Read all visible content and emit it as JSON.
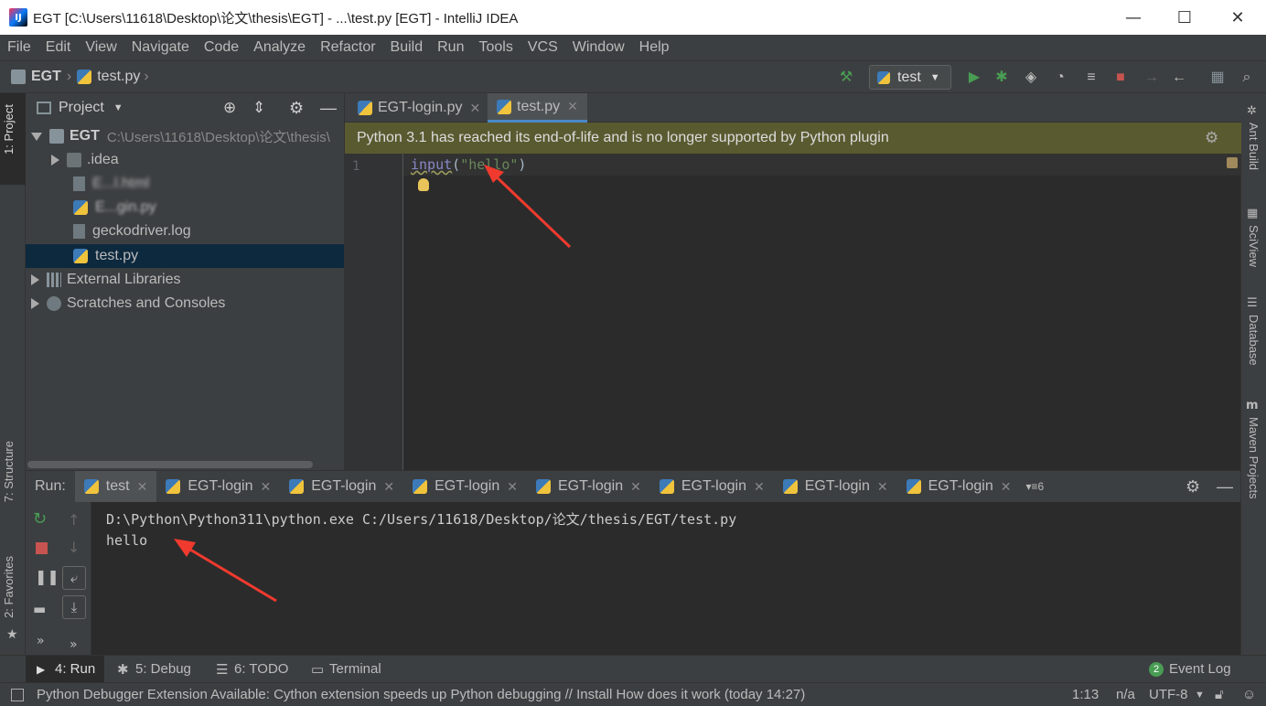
{
  "window": {
    "title": "EGT [C:\\Users\\11618\\Desktop\\论文\\thesis\\EGT] - ...\\test.py [EGT] - IntelliJ IDEA",
    "logo": "IJ"
  },
  "menu": [
    "File",
    "Edit",
    "View",
    "Navigate",
    "Code",
    "Analyze",
    "Refactor",
    "Build",
    "Run",
    "Tools",
    "VCS",
    "Window",
    "Help"
  ],
  "breadcrumb": {
    "project": "EGT",
    "file": "test.py"
  },
  "run_config": "test",
  "left_strip": {
    "project": "1: Project",
    "structure": "7: Structure",
    "favorites": "2: Favorites"
  },
  "right_strip": {
    "ant": "Ant Build",
    "sciview": "SciView",
    "database": "Database",
    "maven": "Maven Projects"
  },
  "project_panel": {
    "title": "Project",
    "tree": [
      {
        "label": "EGT",
        "extra": "C:\\Users\\11618\\Desktop\\论文\\thesis\\"
      },
      {
        "label": ".idea"
      },
      {
        "label": "E...l.html"
      },
      {
        "label": "E...gin.py"
      },
      {
        "label": "geckodriver.log"
      },
      {
        "label": "test.py"
      },
      {
        "label": "External Libraries"
      },
      {
        "label": "Scratches and Consoles"
      }
    ]
  },
  "editor": {
    "tabs": [
      {
        "label": "EGT-login.py"
      },
      {
        "label": "test.py"
      }
    ],
    "banner": "Python 3.1 has reached its end-of-life and is no longer supported by Python plugin",
    "line_number": "1",
    "code": {
      "fn": "input",
      "open": "(",
      "str": "\"hello\"",
      "close": ")"
    }
  },
  "run_panel": {
    "label": "Run:",
    "tabs": [
      "test",
      "EGT-login",
      "EGT-login",
      "EGT-login",
      "EGT-login",
      "EGT-login",
      "EGT-login",
      "EGT-login"
    ],
    "more": "6",
    "console": [
      "D:\\Python\\Python311\\python.exe C:/Users/11618/Desktop/论文/thesis/EGT/test.py",
      "hello"
    ]
  },
  "bottom_tabs": {
    "run": "4: Run",
    "debug": "5: Debug",
    "todo": "6: TODO",
    "terminal": "Terminal",
    "event_log": "Event Log",
    "event_count": "2"
  },
  "status": {
    "message": "Python Debugger Extension Available: Cython extension speeds up Python debugging // Install How does it work (today 14:27)",
    "position": "1:13",
    "na": "n/a",
    "encoding": "UTF-8"
  }
}
